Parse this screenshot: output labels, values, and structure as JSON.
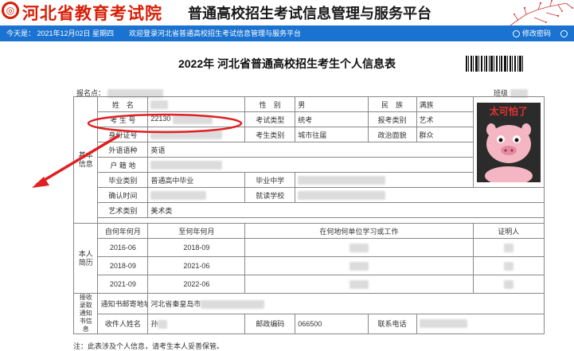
{
  "header": {
    "logo_text": "河北省教育考试院",
    "platform_title": "普通高校招生考试信息管理与服务平台"
  },
  "navbar": {
    "today": "今天是： 2021年12月02日 星期四",
    "welcome": "欢迎登录河北省普通高校招生考试信息管理与服务平台",
    "change_password": "修改密码",
    "exit_label": "退"
  },
  "document": {
    "title": "2022年 河北省普通高校招生考生个人信息表",
    "report_point_label": "报名点：",
    "class_label": "班级"
  },
  "basic_info": {
    "section_label": "基本信息",
    "name_label": "姓　名",
    "gender_label": "性　别",
    "gender": "男",
    "ethnicity_label": "民　族",
    "ethnicity": "满族",
    "exam_no_label": "考 生 号",
    "exam_no": "22130",
    "exam_type_label": "考试类型",
    "exam_type": "统考",
    "apply_category_label": "报考类别",
    "apply_category": "艺术",
    "id_label": "身份证号",
    "examinee_category_label": "考生类别",
    "examinee_category": "城市往届",
    "politics_label": "政治面貌",
    "politics": "群众",
    "foreign_lang_label": "外语语种",
    "foreign_lang": "英语",
    "household_label": "户 籍 地",
    "grad_type_label": "毕业类别",
    "grad_type": "普通高中毕业",
    "grad_school_label": "毕业中学",
    "confirm_time_label": "确认时间",
    "study_school_label": "就读学校",
    "art_category_label": "艺术类别",
    "art_category": "美术类",
    "photo_caption": "太可怕了"
  },
  "resume": {
    "section_label": "本人简历",
    "headers": [
      "自何年何月",
      "至何年何月",
      "在何地何单位学习或工作",
      "证明人"
    ],
    "rows": [
      {
        "from": "2016-06",
        "to": "2018-09"
      },
      {
        "from": "2018-09",
        "to": "2021-06"
      },
      {
        "from": "2021-09",
        "to": "2022-06"
      }
    ]
  },
  "mail": {
    "section_label": "接收录取通知书信息",
    "address_label": "通知书邮寄地址",
    "address": "河北省秦皇岛市",
    "recipient_label": "收件人姓名",
    "recipient": "孙",
    "postcode_label": "邮政编码",
    "postcode": "066500",
    "phone_label": "联系电话"
  },
  "footnote": "注：此表涉及个人信息，请考生本人妥善保管。",
  "colors": {
    "brand_red": "#d81e06",
    "nav_blue": "#1a73d1",
    "annotation_red": "#e02020"
  }
}
